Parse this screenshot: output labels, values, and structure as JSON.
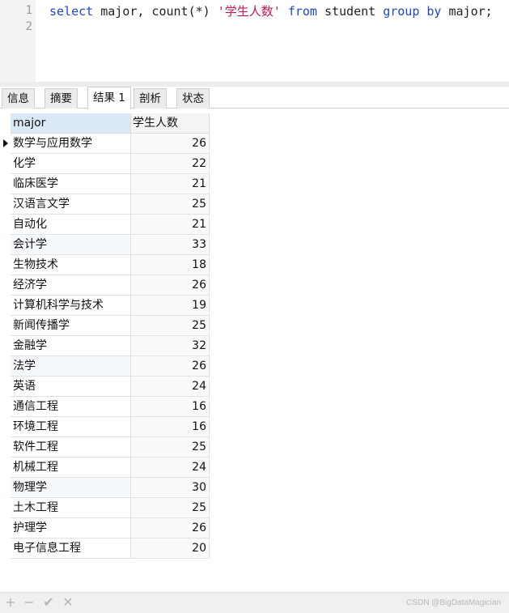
{
  "editor": {
    "line_numbers": [
      "1",
      "2"
    ],
    "sql": {
      "kw_select": "select",
      "part_1": " major, count(*) ",
      "alias": "'学生人数'",
      "space_1": " ",
      "kw_from": "from",
      "part_2": " student ",
      "kw_group": "group",
      "space_2": " ",
      "kw_by": "by",
      "part_3": " major;"
    }
  },
  "tabs": [
    {
      "label": "信息",
      "active": false
    },
    {
      "label": "摘要",
      "active": false
    },
    {
      "label": "结果 1",
      "active": true
    },
    {
      "label": "剖析",
      "active": false
    },
    {
      "label": "状态",
      "active": false
    }
  ],
  "grid": {
    "columns": [
      "major",
      "学生人数"
    ],
    "rows": [
      {
        "major": "数学与应用数学",
        "count": "26"
      },
      {
        "major": "化学",
        "count": "22"
      },
      {
        "major": "临床医学",
        "count": "21"
      },
      {
        "major": "汉语言文学",
        "count": "25"
      },
      {
        "major": "自动化",
        "count": "21"
      },
      {
        "major": "会计学",
        "count": "33"
      },
      {
        "major": "生物技术",
        "count": "18"
      },
      {
        "major": "经济学",
        "count": "26"
      },
      {
        "major": "计算机科学与技术",
        "count": "19"
      },
      {
        "major": "新闻传播学",
        "count": "25"
      },
      {
        "major": "金融学",
        "count": "32"
      },
      {
        "major": "法学",
        "count": "26"
      },
      {
        "major": "英语",
        "count": "24"
      },
      {
        "major": "通信工程",
        "count": "16"
      },
      {
        "major": "环境工程",
        "count": "16"
      },
      {
        "major": "软件工程",
        "count": "25"
      },
      {
        "major": "机械工程",
        "count": "24"
      },
      {
        "major": "物理学",
        "count": "30"
      },
      {
        "major": "土木工程",
        "count": "25"
      },
      {
        "major": "护理学",
        "count": "26"
      },
      {
        "major": "电子信息工程",
        "count": "20"
      }
    ]
  },
  "toolbar": {
    "add_icon": "plus-icon",
    "add_glyph": "+",
    "remove_icon": "minus-icon",
    "remove_glyph": "−",
    "apply_icon": "check-icon",
    "apply_glyph": "✔",
    "cancel_icon": "close-icon",
    "cancel_glyph": "✕"
  },
  "watermark": "CSDN @BigDataMagician"
}
